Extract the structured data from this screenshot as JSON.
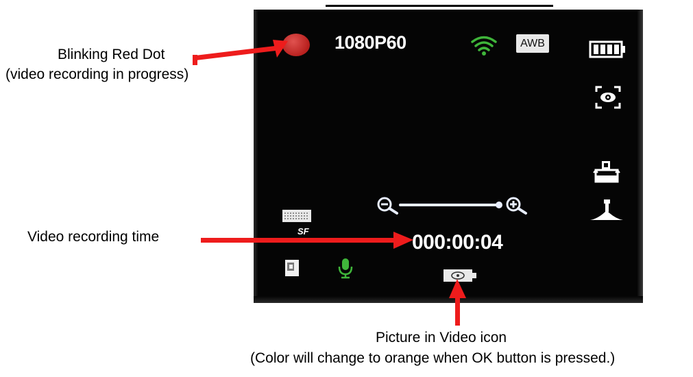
{
  "screen": {
    "recording_indicator": "recording-dot",
    "resolution": "1080P60",
    "wifi_icon": "wifi-icon",
    "wifi_color": "#3fb53a",
    "awb_label": "AWB",
    "battery_icon": "battery-icon",
    "exposure_icon": "exposure-eye-icon",
    "stabilize_icon": "stabilization-icon",
    "tripod_icon": "tripod-icon",
    "zoom": {
      "out_icon": "zoom-out-icon",
      "in_icon": "zoom-in-icon",
      "level": 1.0
    },
    "quality_icon": "image-quality-icon",
    "quality_label": "SF",
    "recording_time": "000:00:04",
    "card_icon": "memory-card-icon",
    "mic_icon": "microphone-icon",
    "mic_color": "#3fb53a",
    "piv_icon": "picture-in-video-icon"
  },
  "callouts": {
    "rec_dot_title": "Blinking Red Dot",
    "rec_dot_subtitle": "(video recording in progress)",
    "time": "Video recording time",
    "piv_title": "Picture in Video icon",
    "piv_subtitle": "(Color will change to orange when OK button is pressed.)"
  },
  "colors": {
    "arrow": "#ee1c1c",
    "rec_dot": "#c9302c",
    "screen_bg": "#050505"
  }
}
